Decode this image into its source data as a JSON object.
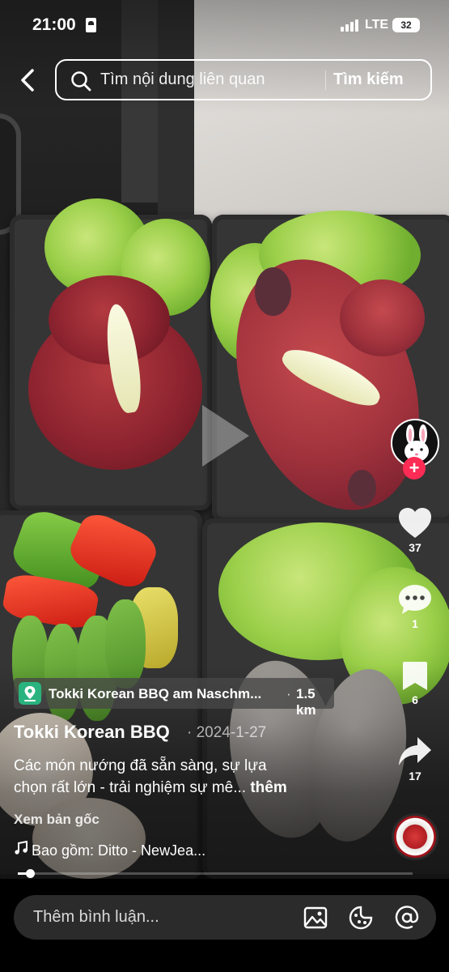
{
  "status_bar": {
    "time": "21:00",
    "network": "LTE",
    "battery": "32"
  },
  "search": {
    "placeholder": "Tìm nội dung liên quan",
    "button_label": "Tìm kiếm"
  },
  "rail": {
    "likes": "37",
    "comments": "1",
    "saves": "6",
    "shares": "17",
    "follow_symbol": "+"
  },
  "post": {
    "location_name": "Tokki Korean BBQ am Naschm...",
    "location_separator": "·",
    "location_distance": "1.5 km",
    "author": "Tokki Korean BBQ",
    "date": "· 2024-1-27",
    "caption_line1": "Các món nướng đã sẵn sàng, sự lựa",
    "caption_line2": "chọn rất lớn - trải nghiệm sự mê...",
    "caption_more": "thêm",
    "see_original": "Xem bản gốc",
    "music": "Bao gồm: Ditto - NewJea...",
    "progress": 0.03
  },
  "comment_bar": {
    "placeholder": "Thêm bình luận..."
  },
  "icons": {
    "back": "back-arrow-icon",
    "search": "search-icon",
    "like": "heart-icon",
    "comment": "comment-bubble-icon",
    "save": "bookmark-icon",
    "share": "share-arrow-icon",
    "location": "location-pin-icon",
    "music": "music-note-icon",
    "image": "image-icon",
    "emoji": "emoji-icon",
    "mention": "at-mention-icon"
  },
  "colors": {
    "accent": "#fe2c55",
    "location_pin": "#2ab37e"
  }
}
